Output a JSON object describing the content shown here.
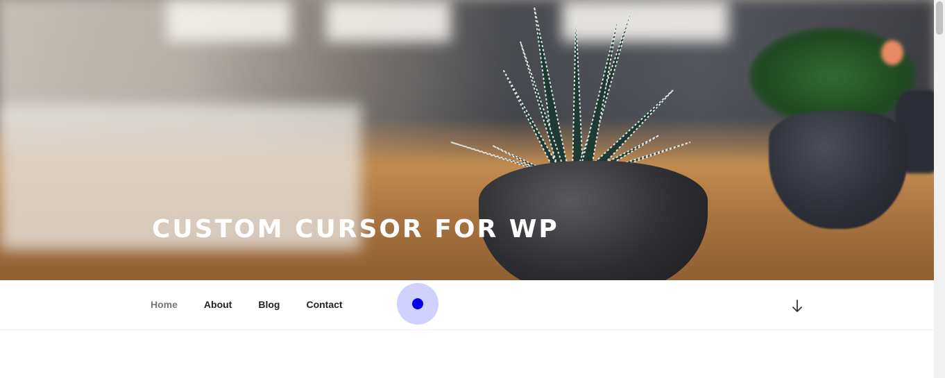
{
  "site": {
    "title": "CUSTOM CURSOR FOR WP"
  },
  "nav": {
    "items": [
      {
        "label": "Home",
        "current": true
      },
      {
        "label": "About",
        "current": false
      },
      {
        "label": "Blog",
        "current": false
      },
      {
        "label": "Contact",
        "current": false
      }
    ],
    "scroll_icon": "arrow-down-icon"
  },
  "cursor": {
    "ring_color": "#8c8cff",
    "dot_color": "#0000ee"
  },
  "hero": {
    "image": "succulent-plant-on-wooden-desk"
  }
}
